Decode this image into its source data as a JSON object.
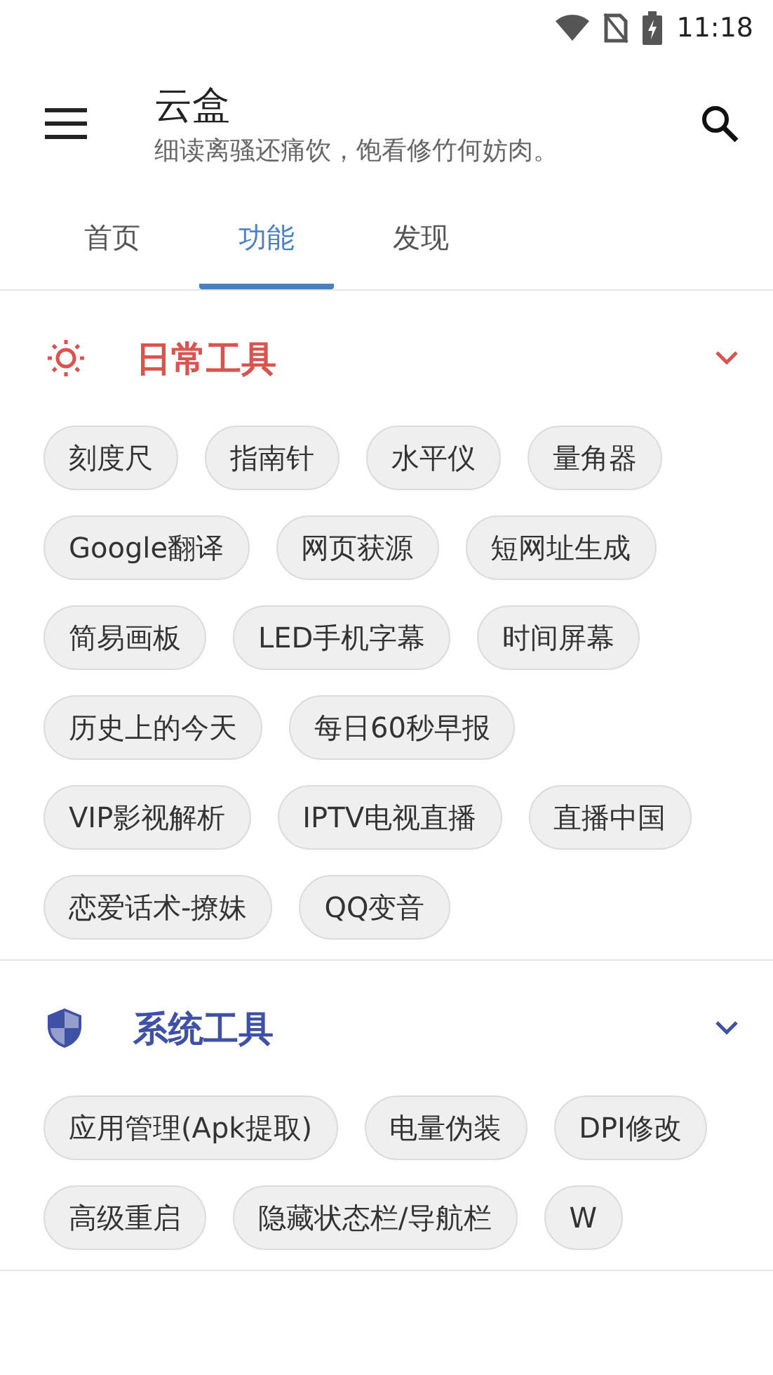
{
  "status_bar": {
    "time": "11:18"
  },
  "header": {
    "title": "云盒",
    "subtitle": "细读离骚还痛饮，饱看修竹何妨肉。"
  },
  "tabs": [
    {
      "label": "首页",
      "selected": false
    },
    {
      "label": "功能",
      "selected": true
    },
    {
      "label": "发现",
      "selected": false
    }
  ],
  "sections": [
    {
      "kind": "sun",
      "title": "日常工具",
      "color": "#d9534f",
      "expanded": true,
      "chips": [
        "刻度尺",
        "指南针",
        "水平仪",
        "量角器",
        "Google翻译",
        "网页获源",
        "短网址生成",
        "简易画板",
        "LED手机字幕",
        "时间屏幕",
        "历史上的今天",
        "每日60秒早报",
        "VIP影视解析",
        "IPTV电视直播",
        "直播中国",
        "恋爱话术-撩妹",
        "QQ变音"
      ]
    },
    {
      "kind": "shield",
      "title": "系统工具",
      "color": "#3f51a5",
      "expanded": true,
      "chips": [
        "应用管理(Apk提取)",
        "电量伪装",
        "DPI修改",
        "高级重启",
        "隐藏状态栏/导航栏",
        "W"
      ]
    }
  ]
}
